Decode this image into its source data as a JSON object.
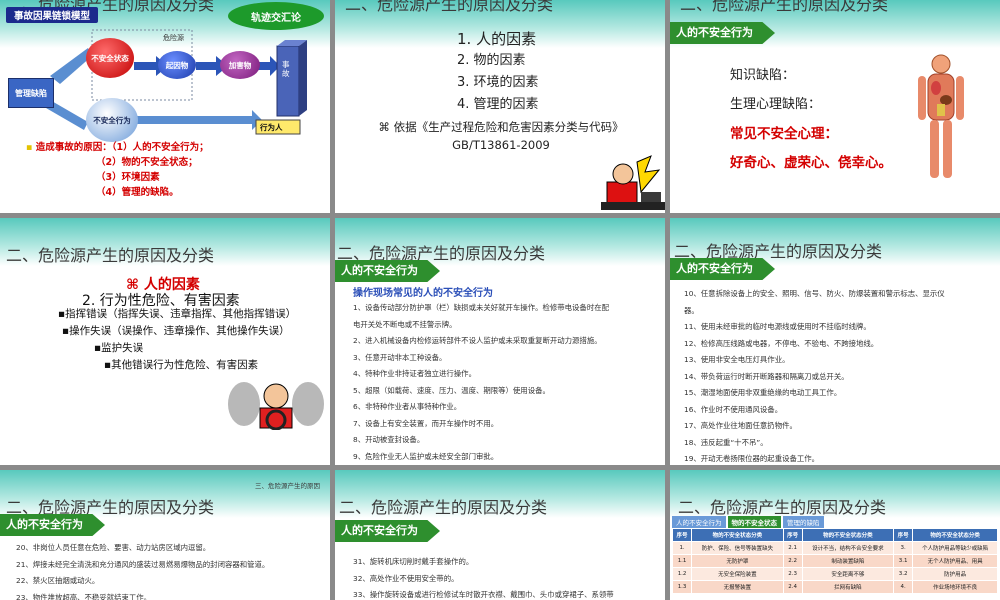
{
  "slide1": {
    "title": "二、危险源产生的原因及分类",
    "chain_label": "事故因果链锁模型",
    "callout": "轨迹交汇论",
    "node_unsafe_state": "不安全状态",
    "node_unsafe_act": "不安全行为",
    "node_mgmt": "管理缺陷",
    "node_trigger": "起因物",
    "node_harm": "加害物",
    "node_hazard": "危险源",
    "node_accident": "事故",
    "node_pedestrian": "行为人",
    "causes_heading": "造成事故的原因：（1）人的不安全行为；",
    "causes": [
      "（2）物的不安全状态；",
      "（3）环境因素",
      "（4）管理的缺陷。"
    ]
  },
  "slide2": {
    "title": "二、危险源产生的原因及分类",
    "items": [
      "1.  人的因素",
      "2.  物的因素",
      "3.  环境的因素",
      "4.  管理的因素"
    ],
    "basis": "⌘  依据《生产过程危险和危害因素分类与代码》GB/T13861-2009"
  },
  "slide3": {
    "title": "二、危险源产生的原因及分类",
    "badge": "人的不安全行为",
    "line1": "知识缺陷：",
    "line2": "生理心理缺陷：",
    "line3": "常见不安全心理：",
    "line4": "好奇心、虚荣心、侥幸心。"
  },
  "slide4": {
    "title": "二、危险源产生的原因及分类",
    "heading": "⌘ 人的因素",
    "sub": "2. 行为性危险、有害因素",
    "bullets": [
      "指挥错误（指挥失误、违章指挥、其他指挥错误）",
      "操作失误（误操作、违章操作、其他操作失误）",
      "监护失误",
      "其他错误行为性危险、有害因素"
    ]
  },
  "slide5": {
    "title": "二、危险源产生的原因及分类",
    "badge": "人的不安全行为",
    "heading": "操作现场常见的人的不安全行为",
    "items": [
      "1、设备传动部分防护罩（栏）缺损或未关好就开车操作。检修带电设备时在配",
      "电开关处不断电或不挂警示牌。",
      "2、进入机械设备内检修运转部件不设人监护或未采取重复断开动力源措施。",
      "3、任意开动非本工种设备。",
      "4、特种作业非持证者独立进行操作。",
      "5、超限（如载荷、速度、压力、温度、期限等）使用设备。",
      "6、非特种作业者从事特种作业。",
      "7、设备上有安全装置，而开车操作时不用。",
      "8、开动被查封设备。",
      "9、危险作业无人监护或未经安全部门审批。"
    ]
  },
  "slide6": {
    "title": "二、危险源产生的原因及分类",
    "badge": "人的不安全行为",
    "items": [
      "10、任意拆除设备上的安全、照明、信号、防火、防爆装置和警示标志、显示仪",
      "器。",
      "11、使用未经审批的临时电源线或使用时不挂临时线牌。",
      "12、检修高压线路或电器，不停电、不验电、不跨接地线。",
      "13、使用非安全电压灯具作业。",
      "14、带负荷运行时断开断路器和隔离刀或总开关。",
      "15、潮湿地面使用非双重绝缘的电动工具工作。",
      "16、作业时不使用通风设备。",
      "17、高处作业往地面任意扔物件。",
      "18、违反起重“十不吊”。",
      "19、开动无卷扬限位器的起重设备工作。"
    ]
  },
  "slide7": {
    "header_small": "三、危险源产生的原因",
    "title": "二、危险源产生的原因及分类",
    "badge": "人的不安全行为",
    "items": [
      "20、非岗位人员任意在危险、要害、动力站房区域内逗留。",
      "21、焊接未经完全清洗和充分通风的盛装过易燃易爆物品的封闭容器和管道。",
      "22、禁火区抽烟或动火。",
      "23、物件堆放超高、不稳妥就结束工作。"
    ]
  },
  "slide8": {
    "title": "二、危险源产生的原因及分类",
    "badge": "人的不安全行为",
    "items": [
      "31、旋转机床切削时戴手套操作的。",
      "32、高处作业不使用安全带的。",
      "33、操作旋转设备或进行检修试车时散开衣襟、戴围巾、头巾或穿裙子、系领带"
    ]
  },
  "slide9": {
    "title": "二、危险源产生的原因及分类",
    "tabs": [
      "人的不安全行为",
      "物的不安全状态",
      "管理的缺陷"
    ],
    "headers": [
      "序号",
      "物的不安全状态分类",
      "序号",
      "物的不安全状态分类",
      "序号",
      "物的不安全状态分类"
    ],
    "rows": [
      [
        "1.",
        "防护、保险、信号等装置缺失",
        "2.1",
        "设计不当，结构不合安全要求",
        "3.",
        "个人防护用品等缺少或缺陷"
      ],
      [
        "1.1",
        "无防护罩",
        "2.2",
        "制动装置缺陷",
        "3.1",
        "无个人防护用品、用具"
      ],
      [
        "1.2",
        "无安全保险装置",
        "2.3",
        "安全距离不够",
        "3.2",
        "防护用品"
      ],
      [
        "1.3",
        "无报警装置",
        "2.4",
        "拦网有缺陷",
        "4.",
        "作业场地环境不良"
      ]
    ]
  }
}
